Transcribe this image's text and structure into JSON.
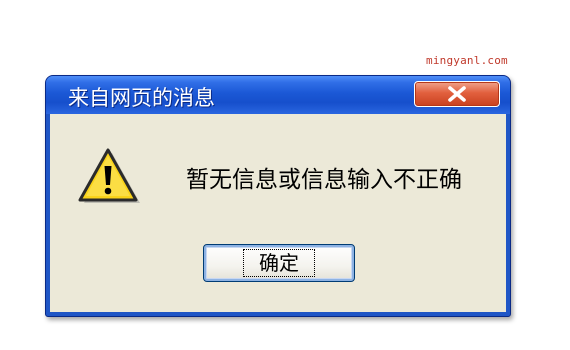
{
  "watermark": {
    "text": "mingyanl.com"
  },
  "dialog": {
    "title": "来自网页的消息",
    "message": "暂无信息或信息输入不正确",
    "ok_label": "确定",
    "icon": "warning-icon",
    "close_icon": "close-icon"
  },
  "colors": {
    "titlebar": "#1f56c6",
    "client_background": "#ece9d8",
    "close_button": "#e2603e",
    "warning_yellow": "#f9d31a",
    "watermark": "#c0392b"
  }
}
